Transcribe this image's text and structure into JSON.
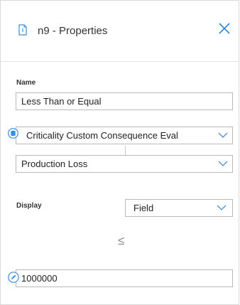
{
  "panel": {
    "title": "n9 - Properties",
    "icons": {
      "document": "document-icon",
      "close": "close-icon"
    }
  },
  "name_section": {
    "label": "Name",
    "value": "Less Than or Equal"
  },
  "source_select": {
    "value": "Criticality Custom Consequence Eval",
    "badge_icon": "database-icon"
  },
  "field_select": {
    "value": "Production Loss"
  },
  "display_section": {
    "label": "Display",
    "value": "Field"
  },
  "operator": {
    "symbol": "≤"
  },
  "constant_input": {
    "value": "1000000",
    "badge_icon": "edit-icon"
  },
  "colors": {
    "accent": "#1a7fd4",
    "border": "#b9b9b9",
    "text": "#222222"
  }
}
